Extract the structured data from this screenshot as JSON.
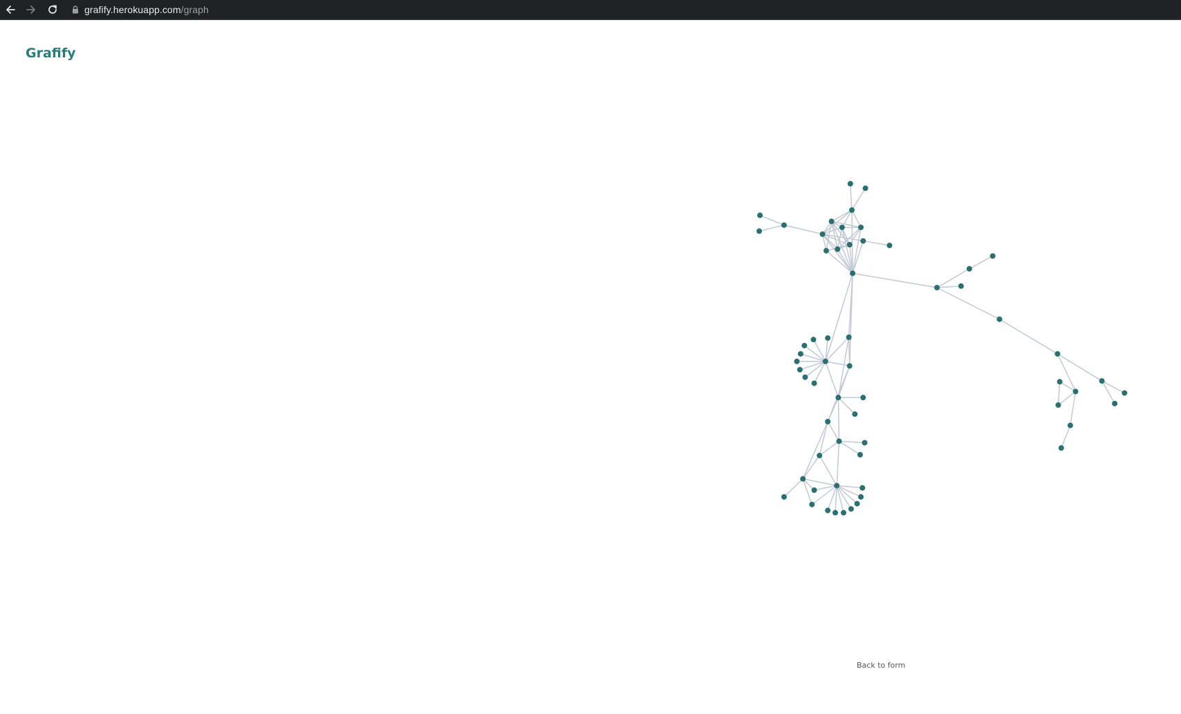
{
  "browser": {
    "url_host": "grafify.herokuapp.com",
    "url_path": "/graph"
  },
  "page": {
    "title": "Grafify",
    "back_link": "Back to form"
  },
  "colors": {
    "browser_bar": "#202124",
    "title": "#2a7a7a",
    "node": "#2a7070",
    "edge": "#c2c8d4"
  },
  "icons": [
    "back-arrow-icon",
    "forward-arrow-icon",
    "reload-icon",
    "lock-icon"
  ]
}
